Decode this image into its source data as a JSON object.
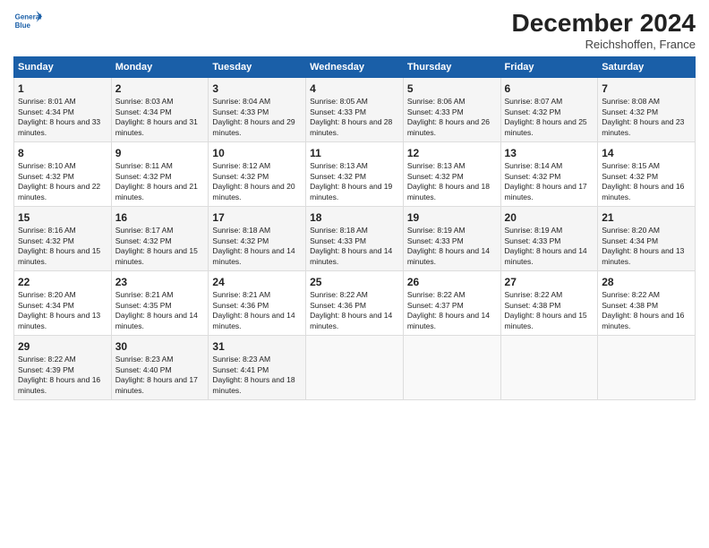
{
  "header": {
    "title": "December 2024",
    "subtitle": "Reichshoffen, France"
  },
  "logo": {
    "line1": "General",
    "line2": "Blue"
  },
  "weekdays": [
    "Sunday",
    "Monday",
    "Tuesday",
    "Wednesday",
    "Thursday",
    "Friday",
    "Saturday"
  ],
  "weeks": [
    [
      {
        "day": "1",
        "sunrise": "Sunrise: 8:01 AM",
        "sunset": "Sunset: 4:34 PM",
        "daylight": "Daylight: 8 hours and 33 minutes."
      },
      {
        "day": "2",
        "sunrise": "Sunrise: 8:03 AM",
        "sunset": "Sunset: 4:34 PM",
        "daylight": "Daylight: 8 hours and 31 minutes."
      },
      {
        "day": "3",
        "sunrise": "Sunrise: 8:04 AM",
        "sunset": "Sunset: 4:33 PM",
        "daylight": "Daylight: 8 hours and 29 minutes."
      },
      {
        "day": "4",
        "sunrise": "Sunrise: 8:05 AM",
        "sunset": "Sunset: 4:33 PM",
        "daylight": "Daylight: 8 hours and 28 minutes."
      },
      {
        "day": "5",
        "sunrise": "Sunrise: 8:06 AM",
        "sunset": "Sunset: 4:33 PM",
        "daylight": "Daylight: 8 hours and 26 minutes."
      },
      {
        "day": "6",
        "sunrise": "Sunrise: 8:07 AM",
        "sunset": "Sunset: 4:32 PM",
        "daylight": "Daylight: 8 hours and 25 minutes."
      },
      {
        "day": "7",
        "sunrise": "Sunrise: 8:08 AM",
        "sunset": "Sunset: 4:32 PM",
        "daylight": "Daylight: 8 hours and 23 minutes."
      }
    ],
    [
      {
        "day": "8",
        "sunrise": "Sunrise: 8:10 AM",
        "sunset": "Sunset: 4:32 PM",
        "daylight": "Daylight: 8 hours and 22 minutes."
      },
      {
        "day": "9",
        "sunrise": "Sunrise: 8:11 AM",
        "sunset": "Sunset: 4:32 PM",
        "daylight": "Daylight: 8 hours and 21 minutes."
      },
      {
        "day": "10",
        "sunrise": "Sunrise: 8:12 AM",
        "sunset": "Sunset: 4:32 PM",
        "daylight": "Daylight: 8 hours and 20 minutes."
      },
      {
        "day": "11",
        "sunrise": "Sunrise: 8:13 AM",
        "sunset": "Sunset: 4:32 PM",
        "daylight": "Daylight: 8 hours and 19 minutes."
      },
      {
        "day": "12",
        "sunrise": "Sunrise: 8:13 AM",
        "sunset": "Sunset: 4:32 PM",
        "daylight": "Daylight: 8 hours and 18 minutes."
      },
      {
        "day": "13",
        "sunrise": "Sunrise: 8:14 AM",
        "sunset": "Sunset: 4:32 PM",
        "daylight": "Daylight: 8 hours and 17 minutes."
      },
      {
        "day": "14",
        "sunrise": "Sunrise: 8:15 AM",
        "sunset": "Sunset: 4:32 PM",
        "daylight": "Daylight: 8 hours and 16 minutes."
      }
    ],
    [
      {
        "day": "15",
        "sunrise": "Sunrise: 8:16 AM",
        "sunset": "Sunset: 4:32 PM",
        "daylight": "Daylight: 8 hours and 15 minutes."
      },
      {
        "day": "16",
        "sunrise": "Sunrise: 8:17 AM",
        "sunset": "Sunset: 4:32 PM",
        "daylight": "Daylight: 8 hours and 15 minutes."
      },
      {
        "day": "17",
        "sunrise": "Sunrise: 8:18 AM",
        "sunset": "Sunset: 4:32 PM",
        "daylight": "Daylight: 8 hours and 14 minutes."
      },
      {
        "day": "18",
        "sunrise": "Sunrise: 8:18 AM",
        "sunset": "Sunset: 4:33 PM",
        "daylight": "Daylight: 8 hours and 14 minutes."
      },
      {
        "day": "19",
        "sunrise": "Sunrise: 8:19 AM",
        "sunset": "Sunset: 4:33 PM",
        "daylight": "Daylight: 8 hours and 14 minutes."
      },
      {
        "day": "20",
        "sunrise": "Sunrise: 8:19 AM",
        "sunset": "Sunset: 4:33 PM",
        "daylight": "Daylight: 8 hours and 14 minutes."
      },
      {
        "day": "21",
        "sunrise": "Sunrise: 8:20 AM",
        "sunset": "Sunset: 4:34 PM",
        "daylight": "Daylight: 8 hours and 13 minutes."
      }
    ],
    [
      {
        "day": "22",
        "sunrise": "Sunrise: 8:20 AM",
        "sunset": "Sunset: 4:34 PM",
        "daylight": "Daylight: 8 hours and 13 minutes."
      },
      {
        "day": "23",
        "sunrise": "Sunrise: 8:21 AM",
        "sunset": "Sunset: 4:35 PM",
        "daylight": "Daylight: 8 hours and 14 minutes."
      },
      {
        "day": "24",
        "sunrise": "Sunrise: 8:21 AM",
        "sunset": "Sunset: 4:36 PM",
        "daylight": "Daylight: 8 hours and 14 minutes."
      },
      {
        "day": "25",
        "sunrise": "Sunrise: 8:22 AM",
        "sunset": "Sunset: 4:36 PM",
        "daylight": "Daylight: 8 hours and 14 minutes."
      },
      {
        "day": "26",
        "sunrise": "Sunrise: 8:22 AM",
        "sunset": "Sunset: 4:37 PM",
        "daylight": "Daylight: 8 hours and 14 minutes."
      },
      {
        "day": "27",
        "sunrise": "Sunrise: 8:22 AM",
        "sunset": "Sunset: 4:38 PM",
        "daylight": "Daylight: 8 hours and 15 minutes."
      },
      {
        "day": "28",
        "sunrise": "Sunrise: 8:22 AM",
        "sunset": "Sunset: 4:38 PM",
        "daylight": "Daylight: 8 hours and 16 minutes."
      }
    ],
    [
      {
        "day": "29",
        "sunrise": "Sunrise: 8:22 AM",
        "sunset": "Sunset: 4:39 PM",
        "daylight": "Daylight: 8 hours and 16 minutes."
      },
      {
        "day": "30",
        "sunrise": "Sunrise: 8:23 AM",
        "sunset": "Sunset: 4:40 PM",
        "daylight": "Daylight: 8 hours and 17 minutes."
      },
      {
        "day": "31",
        "sunrise": "Sunrise: 8:23 AM",
        "sunset": "Sunset: 4:41 PM",
        "daylight": "Daylight: 8 hours and 18 minutes."
      },
      null,
      null,
      null,
      null
    ]
  ]
}
